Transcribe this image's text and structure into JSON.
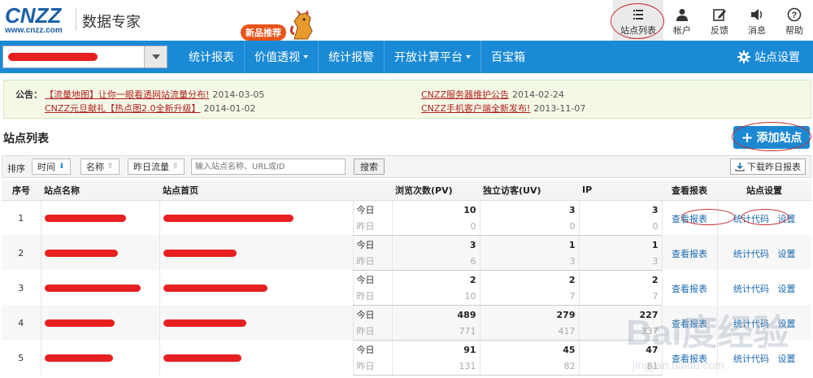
{
  "header": {
    "logo_main": "CNZZ",
    "logo_url": "www.cnzz.com",
    "product_name": "数据专家",
    "promo_badge": "新品推荐",
    "toolbar": [
      {
        "id": "site-list",
        "label": "站点列表",
        "icon": "list-icon"
      },
      {
        "id": "account",
        "label": "帐户",
        "icon": "user-icon"
      },
      {
        "id": "feedback",
        "label": "反馈",
        "icon": "edit-icon"
      },
      {
        "id": "messages",
        "label": "消息",
        "icon": "speaker-icon"
      },
      {
        "id": "help",
        "label": "帮助",
        "icon": "help-icon"
      }
    ]
  },
  "nav": {
    "items": [
      {
        "label": "统计报表",
        "dropdown": false
      },
      {
        "label": "价值透视",
        "dropdown": true
      },
      {
        "label": "统计报警",
        "dropdown": false
      },
      {
        "label": "开放计算平台",
        "dropdown": true
      },
      {
        "label": "百宝箱",
        "dropdown": false
      }
    ],
    "settings_label": "站点设置"
  },
  "notice": {
    "label": "公告：",
    "items": [
      {
        "text": "【流量地图】让你一眼看透网站流量分布!",
        "date": "2014-03-05"
      },
      {
        "text": "CNZZ元旦献礼【热点图2.0全新升级】",
        "date": "2014-01-02"
      },
      {
        "text": "CNZZ服务器维护公告",
        "date": "2014-02-24"
      },
      {
        "text": "CNZZ手机客户端全新发布!",
        "date": "2013-11-07"
      }
    ]
  },
  "section": {
    "title": "站点列表",
    "add_button": "添加站点"
  },
  "filter": {
    "label": "排序",
    "sort_time": "时间",
    "sort_name": "名称",
    "sort_traffic": "昨日流量",
    "search_placeholder": "输入站点名称、URL或ID",
    "search_button": "搜索",
    "download_button": "下载昨日报表"
  },
  "table": {
    "headers": {
      "index": "序号",
      "name": "站点名称",
      "homepage": "站点首页",
      "pv": "浏览次数(PV)",
      "uv": "独立访客(UV)",
      "ip": "IP",
      "report": "查看报表",
      "settings": "站点设置"
    },
    "today_label": "今日",
    "yesterday_label": "昨日",
    "report_link": "查看报表",
    "code_link": "统计代码",
    "settings_link": "设置",
    "rows": [
      {
        "index": "1",
        "today": {
          "pv": "10",
          "uv": "3",
          "ip": "3"
        },
        "yesterday": {
          "pv": "0",
          "uv": "0",
          "ip": "0"
        }
      },
      {
        "index": "2",
        "today": {
          "pv": "3",
          "uv": "1",
          "ip": "1"
        },
        "yesterday": {
          "pv": "6",
          "uv": "3",
          "ip": "3"
        }
      },
      {
        "index": "3",
        "today": {
          "pv": "2",
          "uv": "2",
          "ip": "2"
        },
        "yesterday": {
          "pv": "10",
          "uv": "7",
          "ip": "7"
        }
      },
      {
        "index": "4",
        "today": {
          "pv": "489",
          "uv": "279",
          "ip": "227"
        },
        "yesterday": {
          "pv": "771",
          "uv": "417",
          "ip": "337"
        }
      },
      {
        "index": "5",
        "today": {
          "pv": "91",
          "uv": "45",
          "ip": "47"
        },
        "yesterday": {
          "pv": "131",
          "uv": "82",
          "ip": "81"
        }
      }
    ]
  },
  "watermark": {
    "line1": "Bai度经验",
    "line2": "jingyan.baidu.com"
  },
  "colors": {
    "brand_blue": "#1a8ad6",
    "logo_blue": "#1a5fa6",
    "notice_link": "#b02020",
    "redaction": "#e62020",
    "annotation_circle": "#c32a2a"
  }
}
